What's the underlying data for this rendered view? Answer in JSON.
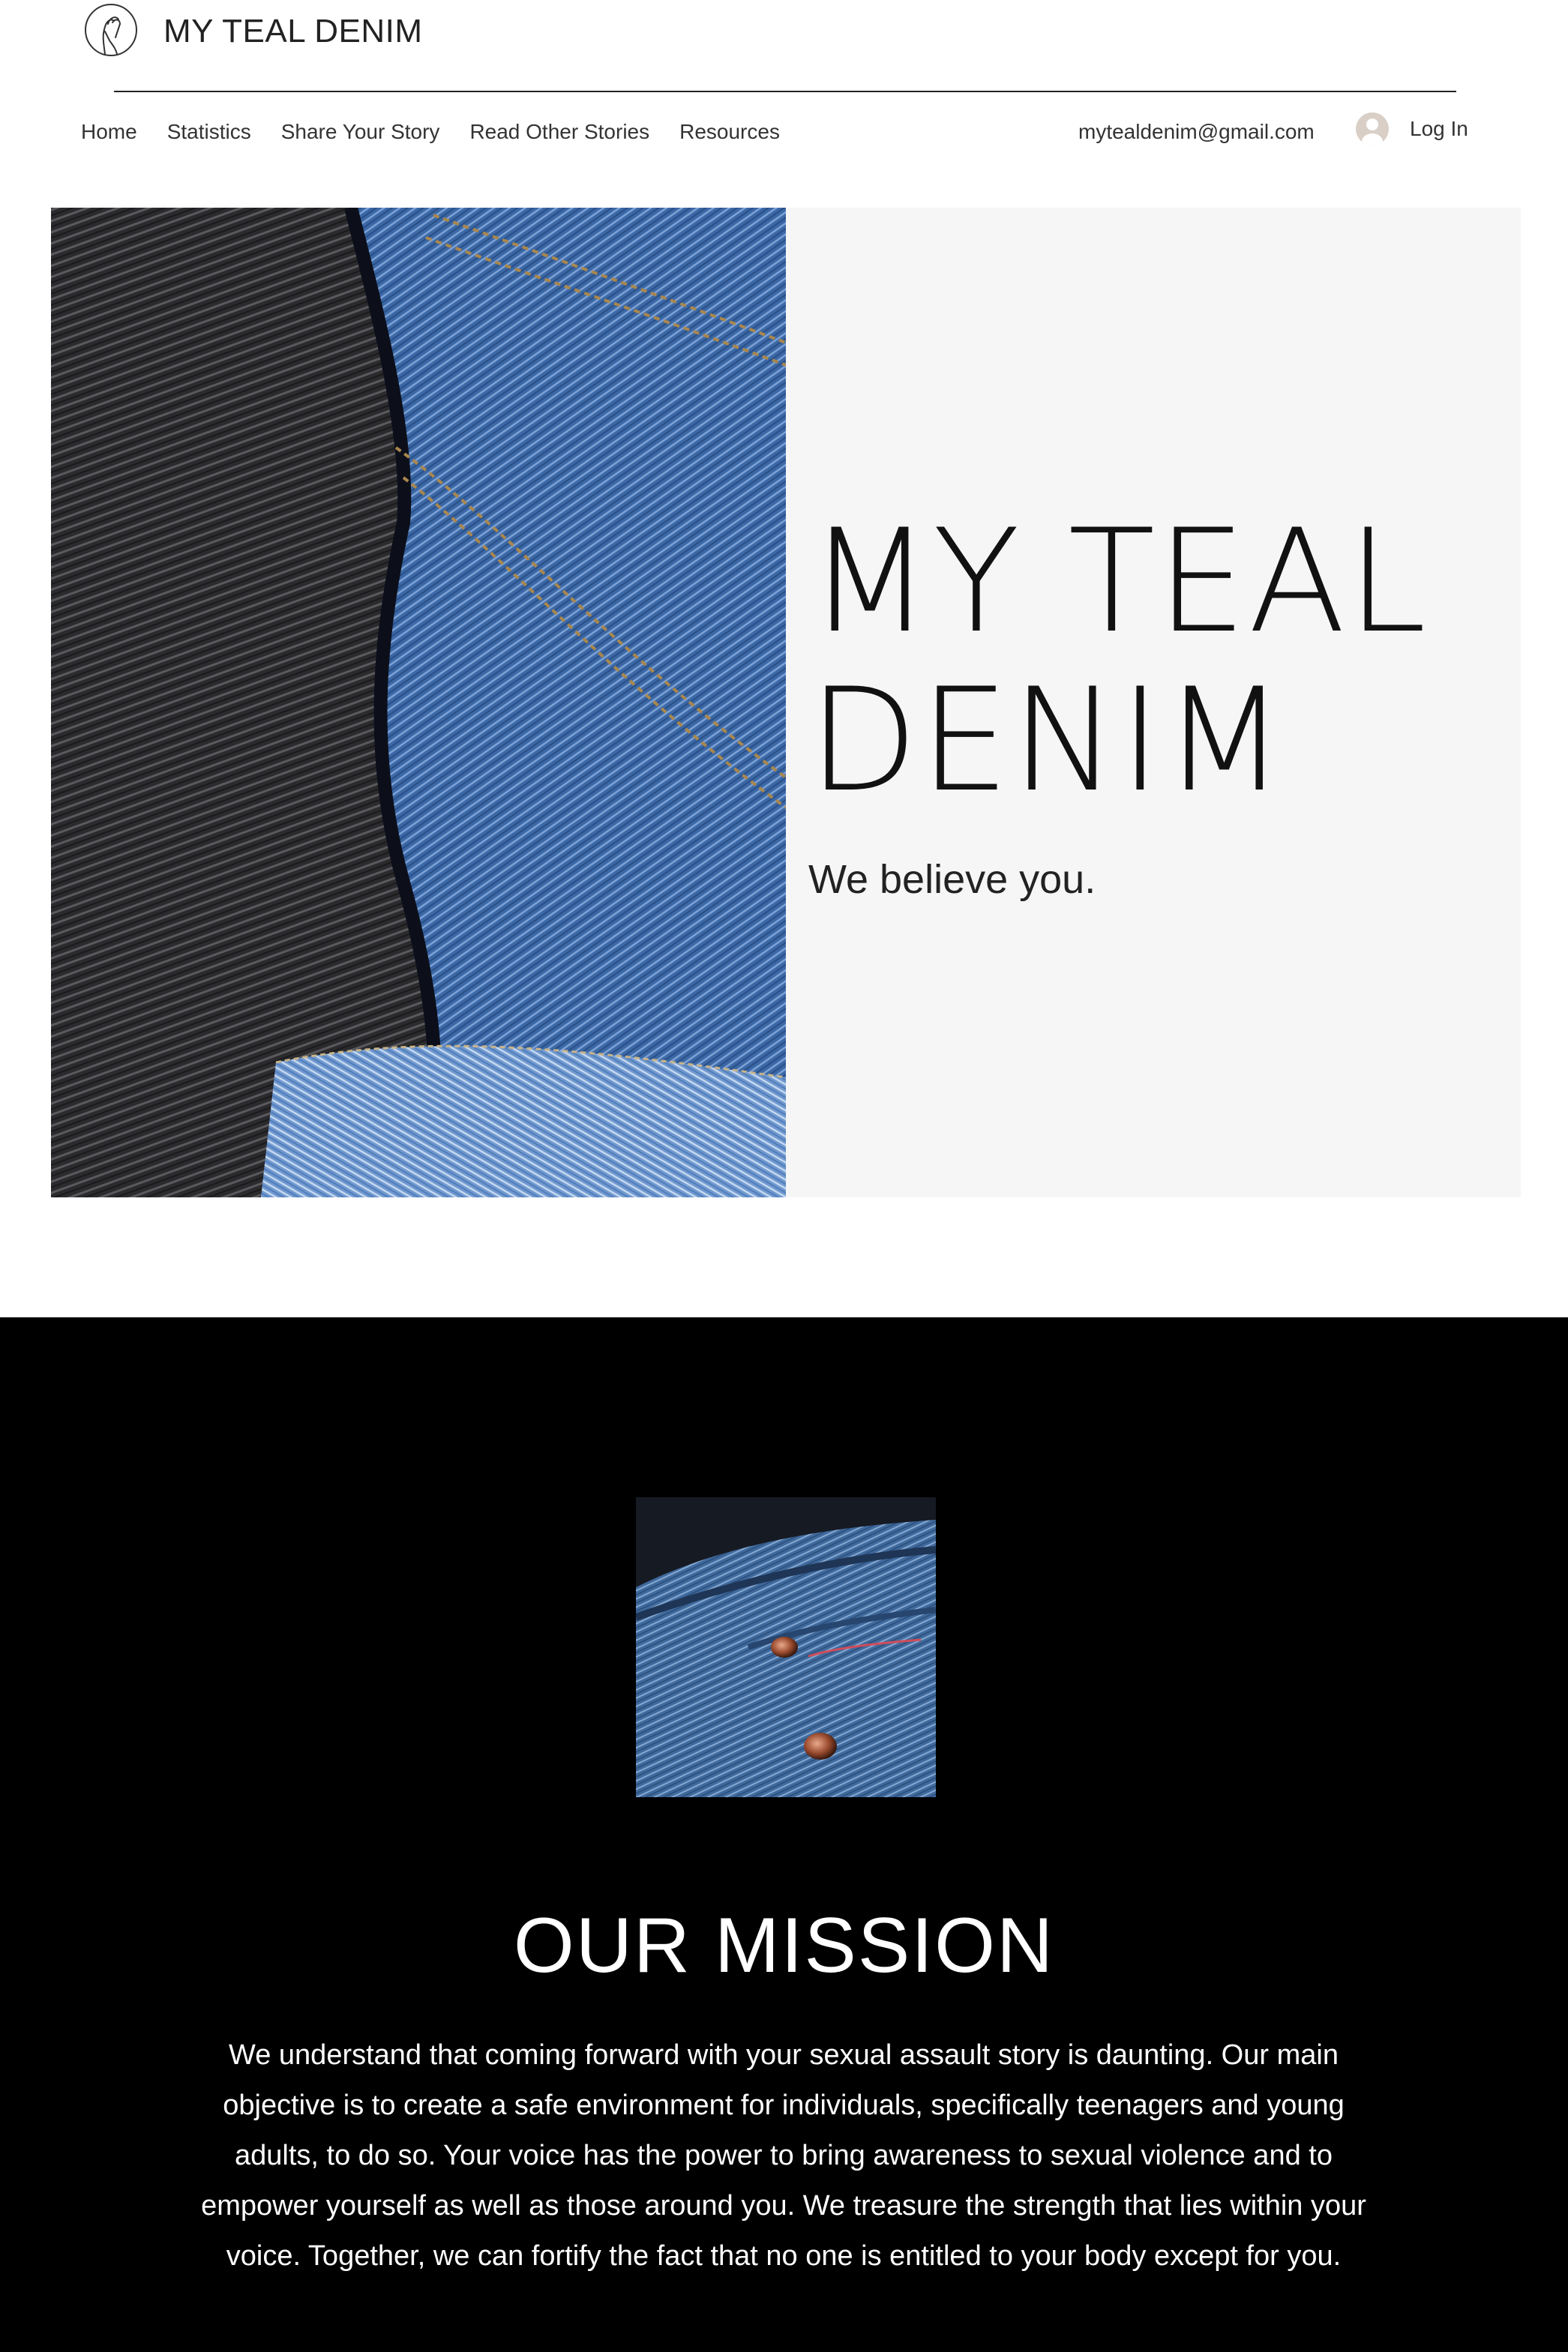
{
  "header": {
    "site_name": "MY TEAL DENIM",
    "logo_icon": "hand-circle-logo-icon",
    "nav": [
      {
        "label": "Home"
      },
      {
        "label": "Statistics"
      },
      {
        "label": "Share Your Story"
      },
      {
        "label": "Read Other Stories"
      },
      {
        "label": "Resources"
      }
    ],
    "email": "mytealdenim@gmail.com",
    "login_label": "Log In"
  },
  "hero": {
    "title_line1": "MY TEAL",
    "title_line2": "DENIM",
    "subtitle": "We believe you.",
    "image": "denim-jeans-closeup-photo"
  },
  "mission": {
    "image": "jeans-pocket-rivets-photo",
    "title": "OUR MISSION",
    "text": "We understand that coming forward with your sexual assault story is daunting. Our main objective is to create a safe environment for individuals, specifically teenagers and young adults, to do so. Your voice has the power to bring awareness to sexual violence and to empower yourself as well as those around you. We treasure the strength that lies within your voice. Together, we can fortify the fact that no one is entitled to your body except for you."
  },
  "colors": {
    "mission_bg": "#000000",
    "hero_panel_bg": "#f6f6f6",
    "denim_blue": "#3d6aa8",
    "denim_dark": "#2a2a2e"
  }
}
